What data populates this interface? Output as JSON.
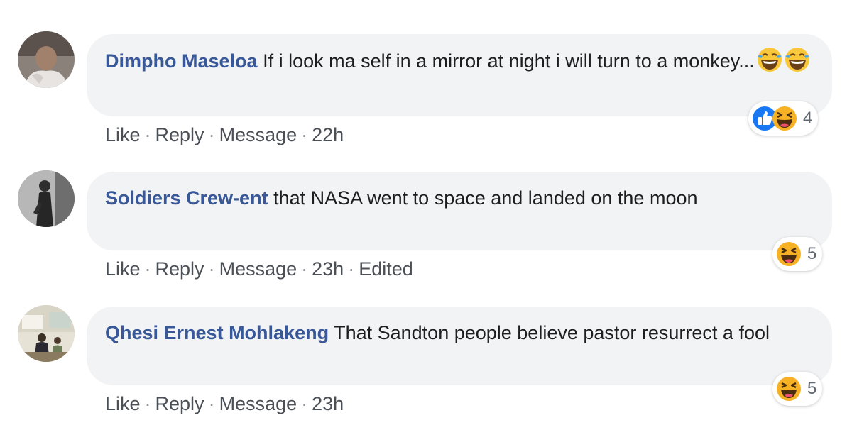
{
  "comments": [
    {
      "author": "Dimpho Maseloa",
      "text": "If i look ma self in a mirror at night i will turn to a monkey...",
      "trailing_emojis": [
        "face-with-tears-of-joy",
        "face-with-tears-of-joy"
      ],
      "actions": [
        "Like",
        "Reply",
        "Message"
      ],
      "time": "22h",
      "edited": "",
      "reactions": {
        "icons": [
          "like-icon",
          "haha-icon"
        ],
        "count": "4"
      }
    },
    {
      "author": "Soldiers Crew-ent",
      "text": "that NASA went to space and landed on the moon",
      "trailing_emojis": [],
      "actions": [
        "Like",
        "Reply",
        "Message"
      ],
      "time": "23h",
      "edited": "Edited",
      "reactions": {
        "icons": [
          "haha-icon"
        ],
        "count": "5"
      }
    },
    {
      "author": "Qhesi Ernest Mohlakeng",
      "text": "That Sandton people believe pastor resurrect a fool",
      "trailing_emojis": [],
      "actions": [
        "Like",
        "Reply",
        "Message"
      ],
      "time": "23h",
      "edited": "",
      "reactions": {
        "icons": [
          "haha-icon"
        ],
        "count": "5"
      }
    }
  ],
  "colors": {
    "author": "#385898",
    "bubble": "#f2f3f5",
    "meta": "#606770",
    "like_blue": "#1877f2",
    "haha_yellow": "#f7b125"
  }
}
